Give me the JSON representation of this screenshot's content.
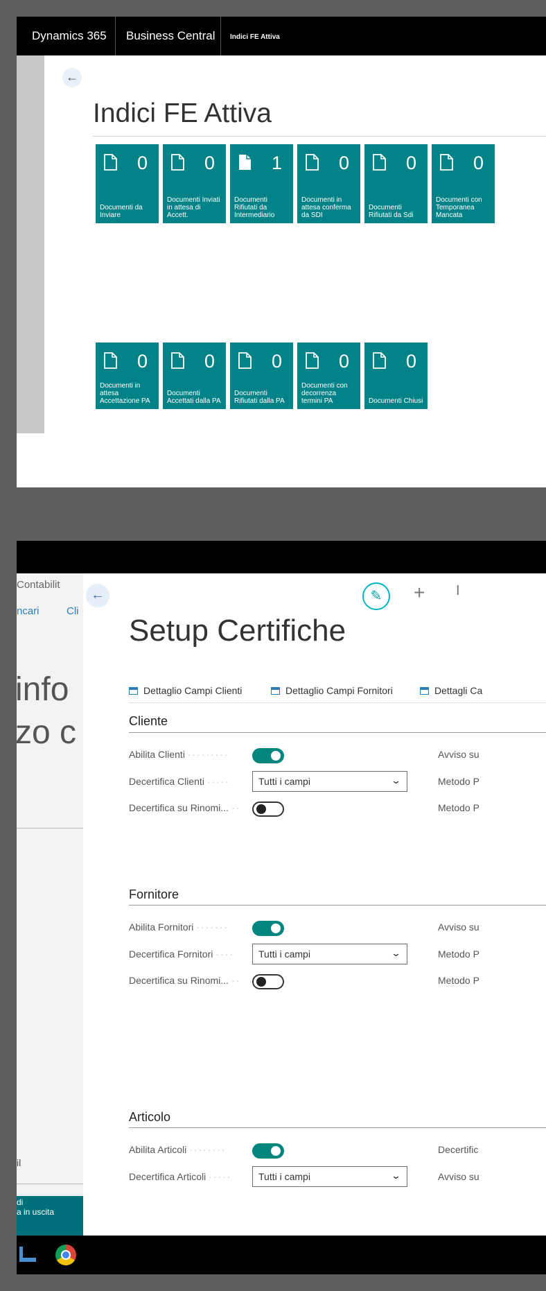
{
  "screen1": {
    "topbar": {
      "product": "Dynamics 365",
      "app": "Business Central",
      "page": "Indici FE Attiva"
    },
    "title": "Indici FE Attiva",
    "tiles_row1": [
      {
        "count": "0",
        "label": "Documenti da Inviare"
      },
      {
        "count": "0",
        "label": "Documenti Inviati in attesa di Accett."
      },
      {
        "count": "1",
        "label": "Documenti Rifiutati da Intermediario"
      },
      {
        "count": "0",
        "label": "Documenti in attesa conferma da SDI"
      },
      {
        "count": "0",
        "label": "Documenti Rifiutati da Sdi"
      },
      {
        "count": "0",
        "label": "Documenti con Temporanea Mancata"
      }
    ],
    "tiles_row2": [
      {
        "count": "0",
        "label": "Documenti in attesa Accettazione PA"
      },
      {
        "count": "0",
        "label": "Documenti Accettati dalla PA"
      },
      {
        "count": "0",
        "label": "Documenti Rifiutati dalla PA"
      },
      {
        "count": "0",
        "label": "Documenti con decorrenza termini PA"
      },
      {
        "count": "0",
        "label": "Documenti Chiusi"
      }
    ],
    "tile_color": "#038387"
  },
  "screen2": {
    "sidebar": {
      "nav1": "Contabilit",
      "nav2a": "ncari",
      "nav2b": "Cli",
      "big1": "info",
      "big2": "zo c",
      "item": "il",
      "blue1": "di",
      "blue2": "a in uscita"
    },
    "title": "Setup Certifiche",
    "actions": [
      "Dettaglio Campi Clienti",
      "Dettaglio Campi Fornitori",
      "Dettagli Ca"
    ],
    "sections": {
      "cliente": {
        "header": "Cliente",
        "fields": {
          "abilita": "Abilita Clienti",
          "decertifica": "Decertifica Clienti",
          "decertifica_value": "Tutti i campi",
          "rinomi": "Decertifica su Rinomi..."
        },
        "right": [
          "Avviso su",
          "Metodo P",
          "Metodo P"
        ]
      },
      "fornitore": {
        "header": "Fornitore",
        "fields": {
          "abilita": "Abilita Fornitori",
          "decertifica": "Decertifica Fornitori",
          "decertifica_value": "Tutti i campi",
          "rinomi": "Decertifica su Rinomi..."
        },
        "right": [
          "Avviso su",
          "Metodo P",
          "Metodo P"
        ]
      },
      "articolo": {
        "header": "Articolo",
        "fields": {
          "abilita": "Abilita Articoli",
          "decertifica": "Decertifica Articoli",
          "decertifica_value": "Tutti i campi"
        },
        "right": [
          "Decertific",
          "Avviso su"
        ]
      }
    },
    "accent": "#00857f"
  }
}
